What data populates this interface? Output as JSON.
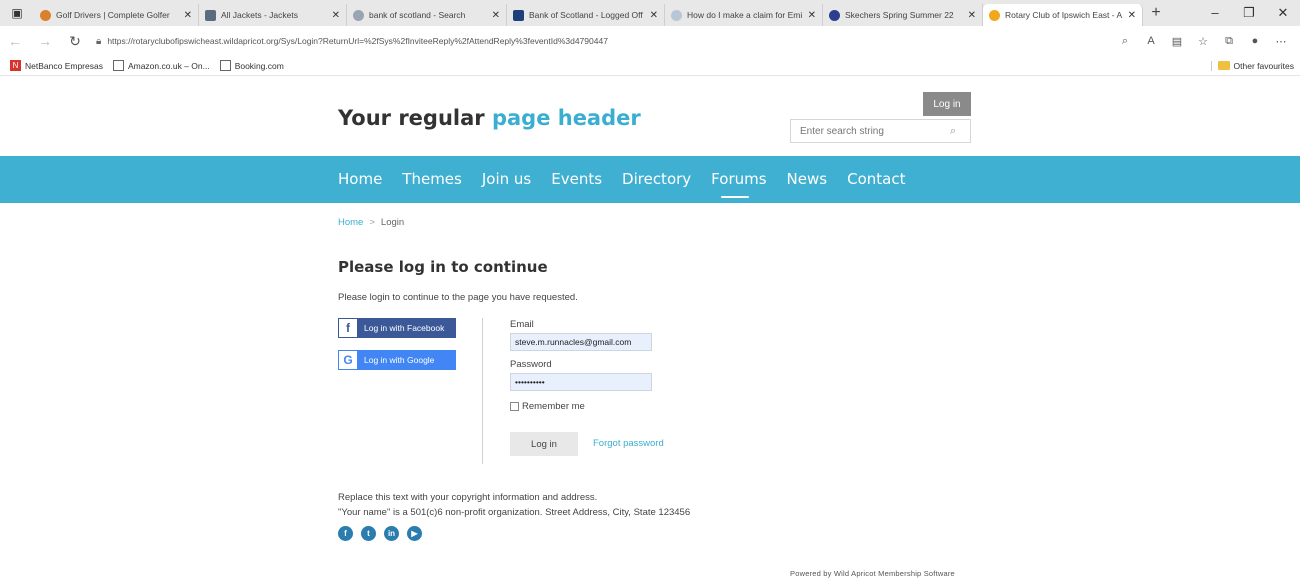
{
  "browser": {
    "tabs": [
      {
        "label": "Golf Drivers | Complete Golfer",
        "icon_color": "#d9822b",
        "icon": "golf-icon"
      },
      {
        "label": "All Jackets - Jackets",
        "icon_color": "#5a6b80",
        "icon": "page-icon"
      },
      {
        "label": "bank of scotland - Search",
        "icon_color": "#9aa5b1",
        "icon": "search-icon"
      },
      {
        "label": "Bank of Scotland - Logged Off",
        "icon_color": "#1f3f7a",
        "icon": "bank-icon"
      },
      {
        "label": "How do I make a claim for Emi",
        "icon_color": "#b8c7d6",
        "icon": "help-icon"
      },
      {
        "label": "Skechers Spring Summer 22",
        "icon_color": "#2b3f8c",
        "icon": "brand-icon"
      },
      {
        "label": "Rotary Club of Ipswich East - A",
        "icon_color": "#f2a81d",
        "icon": "rotary-icon"
      }
    ],
    "url": "https://rotaryclubofipswicheast.wildapricot.org/Sys/Login?ReturnUrl=%2fSys%2fInviteeReply%2fAttendReply%3feventId%3d4790447",
    "favourites": [
      {
        "label": "NetBanco Empresas",
        "icon": "netbanco-icon"
      },
      {
        "label": "Amazon.co.uk – On...",
        "icon": "page-icon"
      },
      {
        "label": "Booking.com",
        "icon": "page-icon"
      }
    ],
    "other_favourites": "Other favourites"
  },
  "site": {
    "title_main": "Your regular ",
    "title_accent": "page header",
    "login_button": "Log in",
    "search_placeholder": "Enter search string",
    "menu": [
      "Home",
      "Themes",
      "Join us",
      "Events",
      "Directory",
      "Forums",
      "News",
      "Contact"
    ],
    "current_menu": "Forums"
  },
  "breadcrumb": {
    "home": "Home",
    "separator": ">",
    "current": "Login"
  },
  "login": {
    "heading": "Please log in to continue",
    "intro": "Please login to continue to the page you have requested.",
    "facebook_button": "Log in with Facebook",
    "google_button": "Log in with Google",
    "email_label": "Email",
    "email_value": "steve.m.runnacles@gmail.com",
    "password_label": "Password",
    "password_value": "••••••••••",
    "remember_label": "Remember me",
    "submit_label": "Log in",
    "forgot_label": "Forgot password"
  },
  "footer": {
    "line1": "Replace this text with your copyright information and address.",
    "line2": "\"Your name\" is a 501(c)6 non-profit organization. Street Address, City, State 123456",
    "social": [
      "facebook-icon",
      "twitter-icon",
      "linkedin-icon",
      "youtube-icon"
    ],
    "powered": "Powered by Wild Apricot Membership Software"
  },
  "colors": {
    "accent": "#3fb0d1",
    "facebook": "#3b5998",
    "google": "#4285f4"
  }
}
